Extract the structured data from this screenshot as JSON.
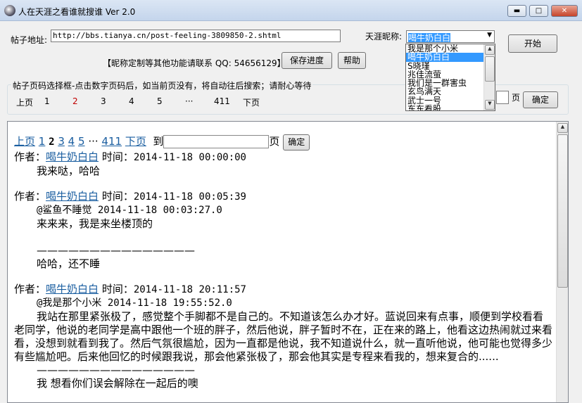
{
  "window": {
    "title": "人在天涯之看谁就搜谁 Ver 2.0",
    "min": "▬",
    "max": "□",
    "close": "✕"
  },
  "form": {
    "url_label": "帖子地址:",
    "url_value": "http://bbs.tianya.cn/post-feeling-3809850-2.shtml",
    "nick_label": "天涯昵称:",
    "nick_selected": "喝牛奶白白",
    "start": "开始",
    "contact": "【昵称定制等其他功能请联系 QQ: 54656129】",
    "save": "保存进度",
    "help": "帮助"
  },
  "nick_options": [
    "我是那个小米",
    "喝牛奶白白",
    "S晓瑾",
    "兆佳流萤",
    "我们是一群害虫",
    "玄鸟满天",
    "武士一号",
    "东东看股"
  ],
  "pager": {
    "legend": "帖子页码选择框-点击数字页码后，如当前页没有，将自动往后搜索；请耐心等待",
    "prev": "上页",
    "pages": [
      "1",
      "2",
      "3",
      "4",
      "5"
    ],
    "ellipsis": "···",
    "last": "411",
    "next": "下页",
    "page_suffix": "页",
    "go": "确定",
    "current": "2"
  },
  "browser": {
    "pager": {
      "prev": "上页",
      "pages": [
        "1",
        "2",
        "3",
        "4",
        "5"
      ],
      "ellipsis": "···",
      "last": "411",
      "next": "下页",
      "to": "到",
      "page_suffix": "页",
      "go": "确定"
    },
    "author_label": "作者：",
    "time_label": "时间：",
    "posts": [
      {
        "author": "喝牛奶白白",
        "time": "2014-11-18 00:00:00",
        "lines": [
          "我来哒，哈哈"
        ]
      },
      {
        "author": "喝牛奶白白",
        "time": "2014-11-18 00:05:39",
        "quote": "@鲨鱼不睡觉 2014-11-18 00:03:27.0",
        "lines": [
          "来来来，我是来坐楼顶的",
          "",
          "———————————————",
          "哈哈，还不睡"
        ]
      },
      {
        "author": "喝牛奶白白",
        "time": "2014-11-18 20:11:57",
        "quote": "@我是那个小米 2014-11-18 19:55:52.0",
        "body": "我站在那里紧张极了，感觉整个手脚都不是自己的。不知道该怎么办才好。蓝说回来有点事，顺便到学校看看老同学，他说的老同学是高中跟他一个班的胖子，然后他说，胖子暂时不在，正在来的路上，他看这边热闹就过来看看，没想到就看到我了。然后气氛很尴尬，因为一直都是他说，我不知道说什么，就一直听他说，他可能也觉得多少有些尴尬吧。后来他回忆的时候跟我说，那会他紧张极了，那会他其实是专程来看我的，想来复合的......",
        "lines": [
          "———————————————",
          "我 想看你们误会解除在一起后的噢"
        ]
      }
    ]
  }
}
